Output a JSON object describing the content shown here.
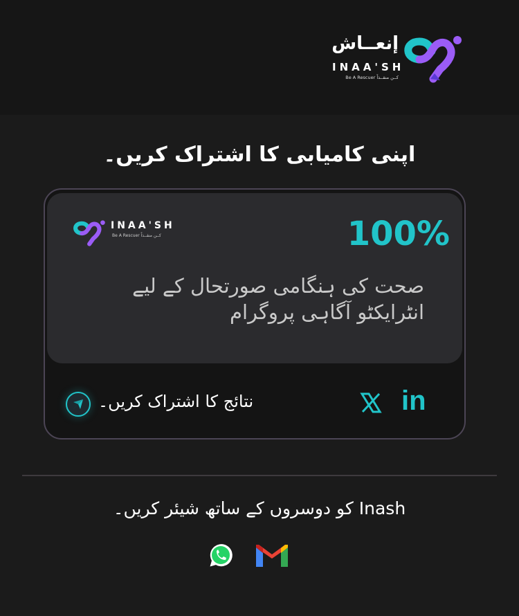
{
  "header": {
    "logo_urdu": "إنعــاش",
    "logo_latin": "INAA'SH",
    "logo_tagline": "Be A Rescuer  کــن منقــذاً"
  },
  "title": "اپنی کامیابی کا اشتراک کریں۔",
  "card": {
    "mini_logo_latin": "INAA'SH",
    "mini_logo_tagline": "Be A Rescuer  کــن منقــذاً",
    "percent": "100%",
    "program_line1": "صحت کی ہنگامی صورتحال کے لیے",
    "program_line2": "انٹرایکٹو آگاہی پروگرام",
    "share_results": "نتائج کا اشتراک کریں۔"
  },
  "footer": {
    "share_text": "Inash کو دوسروں کے ساتھ شیئر کریں۔"
  },
  "icons": {
    "send": "send-icon",
    "x": "x-icon",
    "linkedin": "linkedin-icon",
    "whatsapp": "whatsapp-icon",
    "gmail": "gmail-icon"
  },
  "colors": {
    "accent_teal": "#21c4c9",
    "accent_purple": "#9b5cf6"
  }
}
